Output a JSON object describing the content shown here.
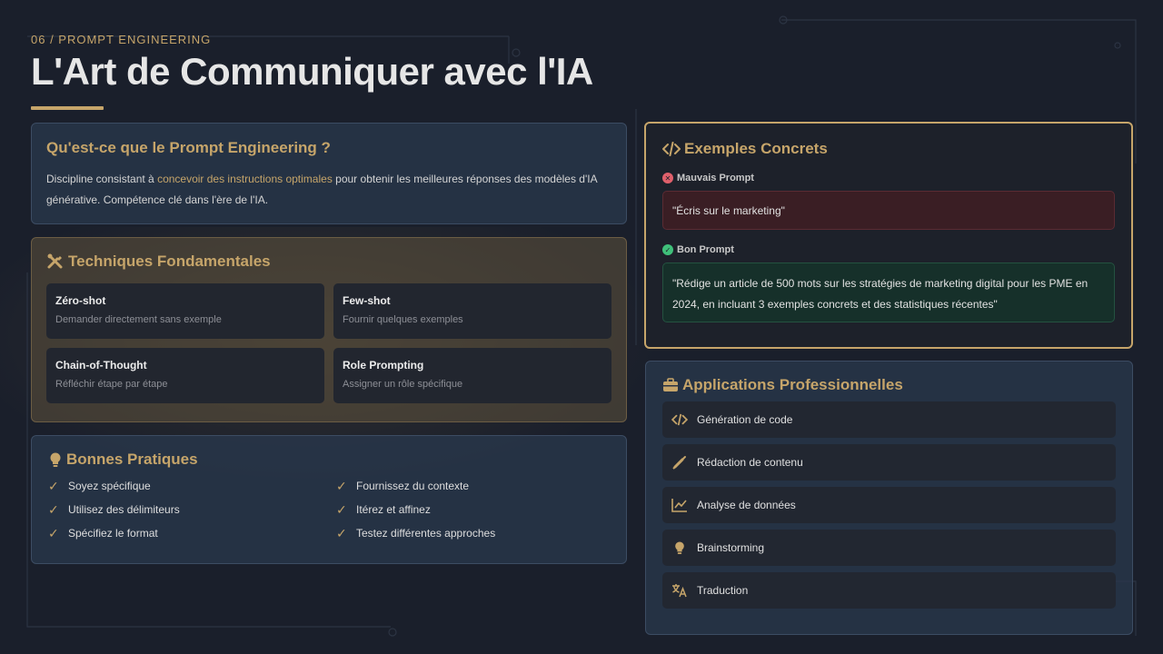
{
  "header": {
    "breadcrumb": "06 / PROMPT  ENGINEERING",
    "title": "L'Art de Communiquer avec l'IA"
  },
  "intro": {
    "title": "Qu'est-ce que le Prompt Engineering ?",
    "text_before": "Discipline consistant à ",
    "text_highlight": "concevoir des instructions optimales",
    "text_after": " pour obtenir les meilleures réponses des modèles d'IA générative. Compétence clé dans l'ère de l'IA."
  },
  "techniques": {
    "title": "Techniques Fondamentales",
    "icon": "tools-icon",
    "items": [
      {
        "name": "Zéro-shot",
        "desc": "Demander directement sans exemple"
      },
      {
        "name": "Few-shot",
        "desc": "Fournir quelques exemples"
      },
      {
        "name": "Chain-of-Thought",
        "desc": "Réfléchir étape par étape"
      },
      {
        "name": "Role Prompting",
        "desc": "Assigner un rôle spécifique"
      }
    ]
  },
  "practices": {
    "title": "Bonnes Pratiques",
    "icon": "lightbulb-icon",
    "items": [
      "Soyez spécifique",
      "Fournissez du contexte",
      "Utilisez des délimiteurs",
      "Itérez et affinez",
      "Spécifiez le format",
      "Testez différentes approches"
    ]
  },
  "examples": {
    "title": "Exemples Concrets",
    "icon": "code-icon",
    "bad_label": "Mauvais Prompt",
    "bad_text": "\"Écris sur le marketing\"",
    "good_label": "Bon Prompt",
    "good_text": "\"Rédige un article de 500 mots sur les stratégies de marketing digital pour les PME en 2024, en incluant 3 exemples concrets et des statistiques  récentes\""
  },
  "applications": {
    "title": "Applications Professionnelles",
    "icon": "briefcase-icon",
    "items": [
      {
        "label": "Génération de code",
        "icon": "code-icon"
      },
      {
        "label": "Rédaction de contenu",
        "icon": "pen-icon"
      },
      {
        "label": "Analyse de données",
        "icon": "chart-line-icon"
      },
      {
        "label": "Brainstorming",
        "icon": "lightbulb-icon"
      },
      {
        "label": "Traduction",
        "icon": "translate-icon"
      }
    ]
  },
  "colors": {
    "accent": "#c6a56a",
    "background": "#1a1f2b",
    "bad": "#e0606b",
    "good": "#3fc07a"
  }
}
